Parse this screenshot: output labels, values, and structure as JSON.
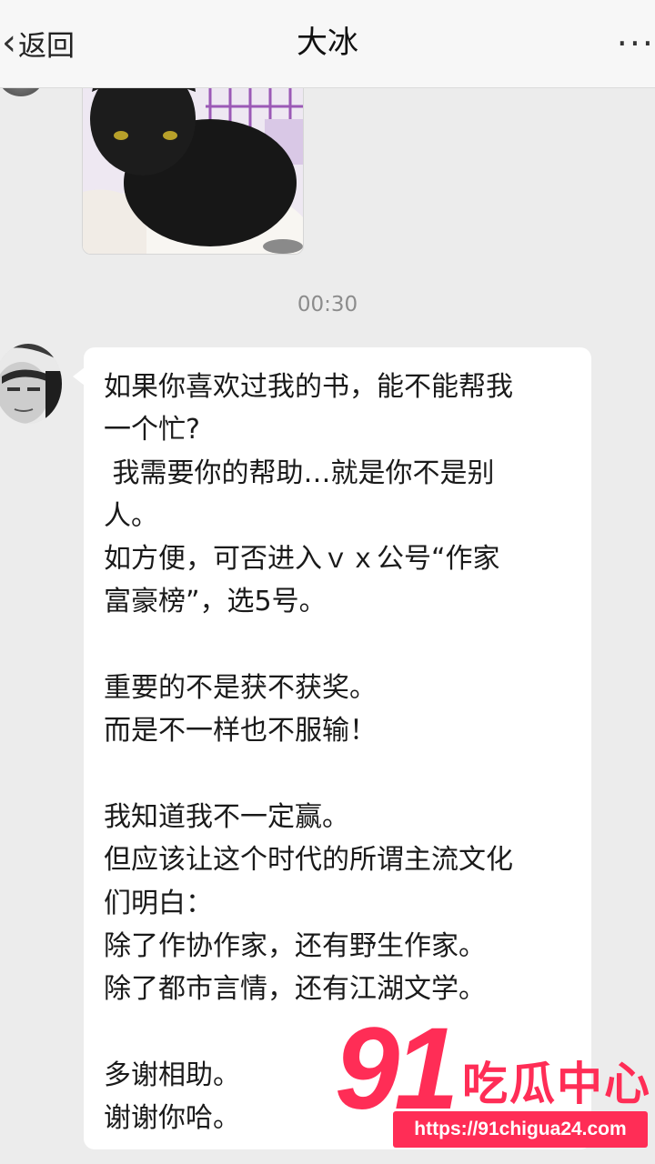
{
  "header": {
    "back_label": "返回",
    "title": "大冰",
    "more_label": "···"
  },
  "icons": {
    "back": "chevron-left-icon",
    "more": "more-dots-icon"
  },
  "timestamp": "00:30",
  "message": {
    "lines": [
      "如果你喜欢过我的书，能不能帮我",
      "一个忙?",
      " 我需要你的帮助…就是你不是别",
      "人。",
      "如方便，可否进入ｖｘ公号“作家",
      "富豪榜”，选5号。",
      "",
      "重要的不是获不获奖。",
      "而是不一样也不服输！",
      "",
      "我知道我不一定赢。",
      "但应该让这个时代的所谓主流文化",
      "们明白：",
      "除了作协作家，还有野生作家。",
      "除了都市言情，还有江湖文学。",
      "",
      "多谢相助。",
      "谢谢你哈。"
    ]
  },
  "watermark": {
    "number": "91",
    "text": "吃瓜中心",
    "url": "https://91chigua24.com"
  },
  "colors": {
    "background": "#ececec",
    "bubble": "#ffffff",
    "watermark": "#ff2d56"
  }
}
